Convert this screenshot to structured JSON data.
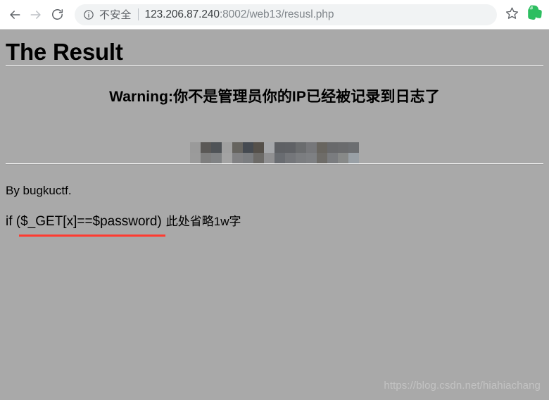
{
  "browser": {
    "back_icon": "back-arrow-icon",
    "forward_icon": "forward-arrow-icon",
    "reload_icon": "reload-icon",
    "info_icon": "info-circle-icon",
    "security_label": "不安全",
    "url_host": "123.206.87.240",
    "url_rest": ":8002/web13/resusl.php",
    "url_full": "123.206.87.240:8002/web13/resusl.php",
    "star_icon": "bookmark-star-icon",
    "extension_icon": "evernote-extension-icon"
  },
  "page": {
    "title": "The Result",
    "warning": "Warning:你不是管理员你的IP已经被记录到日志了",
    "redacted_note": "mosaic-censored-text",
    "by_line": "By bugkuctf.",
    "code_snippet": "if ($_GET[x]==$password)",
    "code_comment": "此处省略1w字",
    "watermark": "https://blog.csdn.net/hiahiachang"
  },
  "colors": {
    "page_background": "#a9a9a9",
    "toolbar_background": "#ffffff",
    "omnibox_background": "#f1f3f4",
    "underline_accent": "#ff3b30",
    "extension_green": "#2dbe60",
    "watermark_gray": "#c3c3c3"
  },
  "mosaic": {
    "cols": 16,
    "rows": 2,
    "cell": 15,
    "row1": [
      "#9a9a9a",
      "#5a5856",
      "#4f5357",
      "#a0a0a0",
      "#66645f",
      "#454a51",
      "#55504a",
      "#a6a8ab",
      "#5e6064",
      "#5f6165",
      "#6a6c6e",
      "#76777a",
      "#68655f",
      "#68696b",
      "#6a6b6d",
      "#6c6e71"
    ],
    "row2": [
      "#9b9b9b",
      "#7e7e7e",
      "#808284",
      "#a3a3a3",
      "#818183",
      "#7b7d80",
      "#6c6a67",
      "#909092",
      "#696c71",
      "#74767a",
      "#7b7d80",
      "#7e8083",
      "#6e6c68",
      "#7a7c7f",
      "#878988",
      "#99a0a6"
    ]
  }
}
